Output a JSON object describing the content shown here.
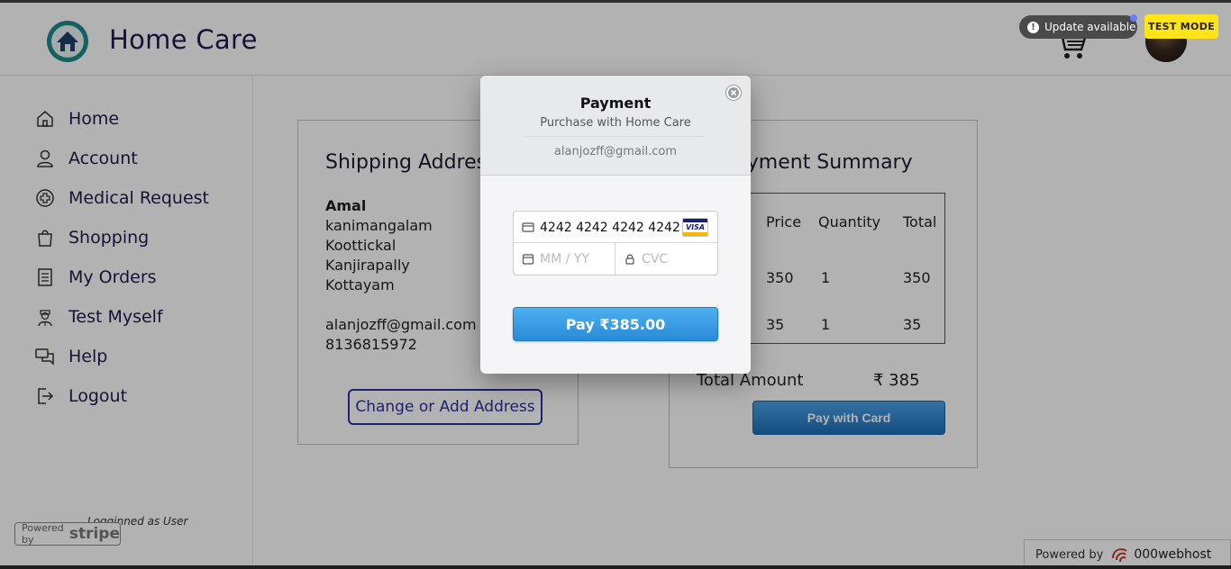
{
  "header": {
    "brand": "Home Care"
  },
  "sidebar": {
    "items": [
      {
        "label": "Home",
        "icon": "home-icon"
      },
      {
        "label": "Account",
        "icon": "user-icon"
      },
      {
        "label": "Medical Request",
        "icon": "medical-icon"
      },
      {
        "label": "Shopping",
        "icon": "shopping-bag-icon"
      },
      {
        "label": "My Orders",
        "icon": "orders-icon"
      },
      {
        "label": "Test Myself",
        "icon": "nurse-icon"
      },
      {
        "label": "Help",
        "icon": "chat-icon"
      },
      {
        "label": "Logout",
        "icon": "logout-icon"
      }
    ],
    "logged_as": "Logginned as User"
  },
  "shipping": {
    "title": "Shipping Address",
    "name": "Amal",
    "lines": [
      "kanimangalam",
      "Koottickal",
      "Kanjirapally",
      "Kottayam"
    ],
    "email": "alanjozff@gmail.com",
    "phone": "8136815972",
    "change_button": "Change or Add Address"
  },
  "summary": {
    "title": "Payment Summary",
    "columns": [
      "Price",
      "Quantity",
      "Total"
    ],
    "rows": [
      {
        "price": "350",
        "quantity": "1",
        "total": "350"
      },
      {
        "price": "35",
        "quantity": "1",
        "total": "35"
      }
    ],
    "total_label": "Total Amount",
    "total_value": "₹ 385",
    "pay_button": "Pay with Card"
  },
  "badges": {
    "update": "Update available",
    "test_mode": "TEST MODE",
    "powered_small": "Powered by",
    "powered_big": "stripe",
    "webhost_small": "Powered by",
    "webhost_big": "000webhost"
  },
  "modal": {
    "title": "Payment",
    "subtitle": "Purchase with Home Care",
    "email": "alanjozff@gmail.com",
    "card_number": "4242 4242 4242 4242",
    "card_brand": "VISA",
    "expiry_placeholder": "MM / YY",
    "cvc_placeholder": "CVC",
    "pay_button": "Pay ₹385.00"
  },
  "colors": {
    "brand_text": "#1f1b4d",
    "pay_blue": "#2a8ad8",
    "test_mode_yellow": "#ffe419"
  }
}
